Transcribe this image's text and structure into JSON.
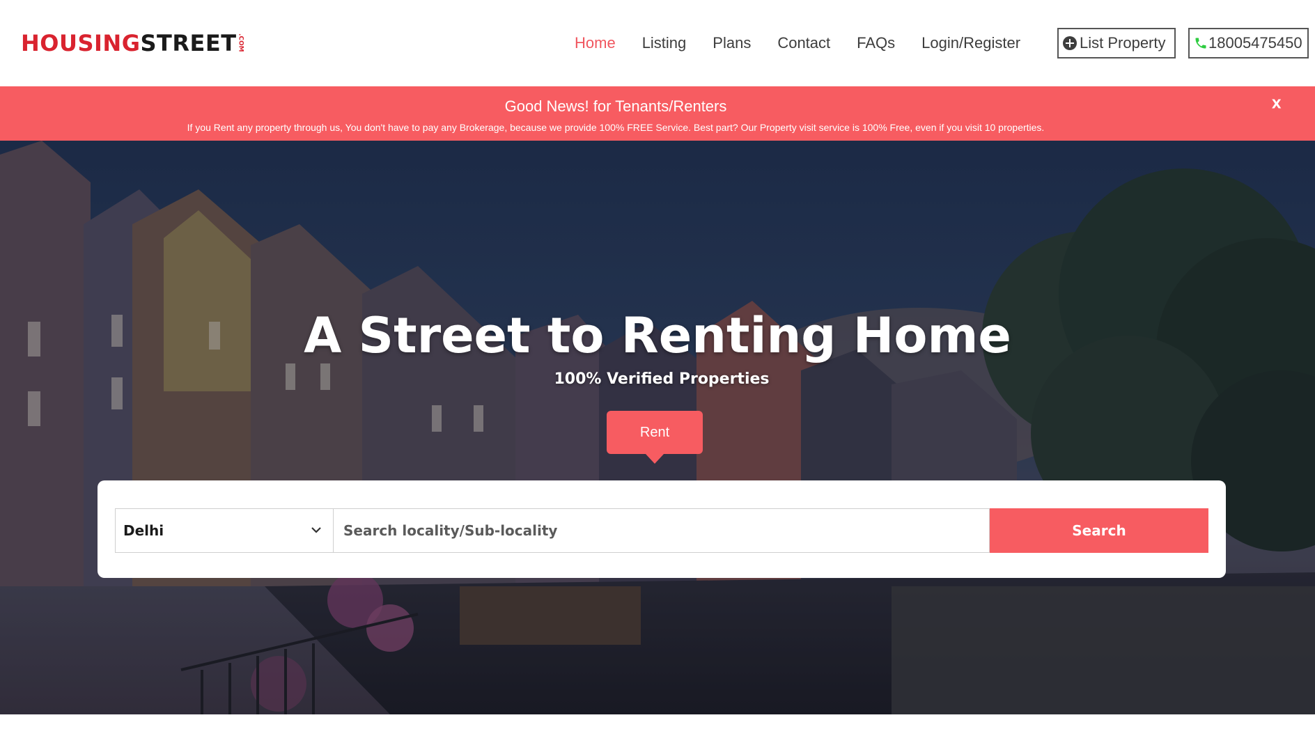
{
  "brand": {
    "logo_part1": "HOUSING",
    "logo_part2": "STREET",
    "logo_suffix": ".COM",
    "primary_color": "#f75c61",
    "logo_red": "#d9232f"
  },
  "nav": {
    "items": [
      {
        "label": "Home",
        "active": true
      },
      {
        "label": "Listing"
      },
      {
        "label": "Plans"
      },
      {
        "label": "Contact"
      },
      {
        "label": "FAQs"
      },
      {
        "label": "Login/Register"
      }
    ],
    "list_property_label": "List Property",
    "list_property_icon": "plus-circle-icon",
    "phone_number": "18005475450",
    "phone_icon": "phone-icon",
    "active_color": "#f0555e"
  },
  "announcement": {
    "title": "Good News! for Tenants/Renters",
    "text": "If you Rent any property through us, You don't have to pay any Brokerage, because we provide 100% FREE Service. Best part? Our Property visit service is 100% Free, even if you visit 10 properties.",
    "close_label": "X"
  },
  "hero": {
    "title": "A Street to Renting Home",
    "subtitle": "100% Verified Properties",
    "tab_label": "Rent"
  },
  "search": {
    "city_value": "Delhi",
    "locality_placeholder": "Search locality/Sub-locality",
    "button_label": "Search"
  }
}
